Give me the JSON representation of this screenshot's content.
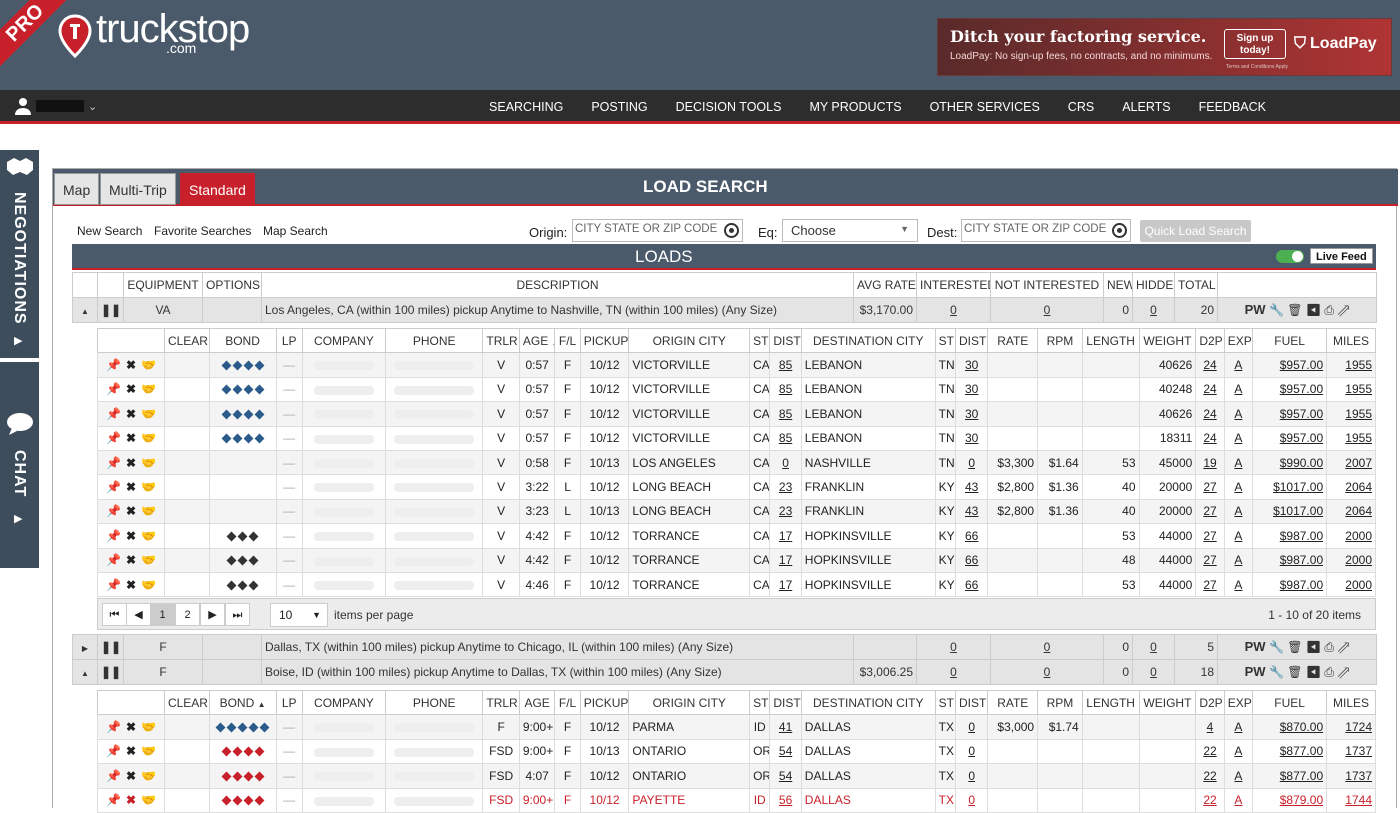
{
  "brand": {
    "pro": "PRO",
    "logo": "truckstop",
    "logo_com": ".com"
  },
  "ad": {
    "headline": "Ditch your factoring service.",
    "sub": "LoadPay: No sign-up fees, no contracts, and no minimums.",
    "button": "Sign up today!",
    "terms": "Terms and Conditions Apply",
    "brand": "LoadPay"
  },
  "nav": [
    "SEARCHING",
    "POSTING",
    "DECISION TOOLS",
    "MY PRODUCTS",
    "OTHER SERVICES",
    "CRS",
    "ALERTS",
    "FEEDBACK"
  ],
  "side": {
    "neg": "NEGOTIATIONS",
    "chat": "CHAT"
  },
  "tabs": [
    "Map",
    "Multi-Trip",
    "Standard"
  ],
  "panel_title": "LOAD SEARCH",
  "search": {
    "links": [
      "New Search",
      "Favorite Searches",
      "Map Search"
    ],
    "origin_label": "Origin:",
    "origin_ph": "CITY STATE OR ZIP CODE",
    "eq_label": "Eq:",
    "eq_value": "Choose",
    "dest_label": "Dest:",
    "dest_ph": "CITY STATE OR ZIP CODE",
    "button": "Quick Load Search"
  },
  "loads_title": "LOADS",
  "live_feed": "Live Feed",
  "top_headers": [
    "EQUIPMENT",
    "OPTIONS",
    "DESCRIPTION",
    "AVG RATE",
    "INTERESTED",
    "NOT INTERESTED",
    "NEW",
    "HIDDEN",
    "TOTAL"
  ],
  "groups": [
    {
      "eq": "VA",
      "desc": "Los Angeles, CA (within 100 miles) pickup Anytime to Nashville, TN (within 100 miles) (Any Size)",
      "avg": "$3,170.00",
      "int": "0",
      "notint": "0",
      "new": "0",
      "hidden": "0",
      "total": "20"
    },
    {
      "eq": "F",
      "desc": "Dallas, TX (within 100 miles) pickup Anytime to Chicago, IL (within 100 miles) (Any Size)",
      "avg": "",
      "int": "0",
      "notint": "0",
      "new": "0",
      "hidden": "0",
      "total": "5"
    },
    {
      "eq": "F",
      "desc": "Boise, ID (within 100 miles) pickup Anytime to Dallas, TX (within 100 miles) (Any Size)",
      "avg": "$3,006.25",
      "int": "0",
      "notint": "0",
      "new": "0",
      "hidden": "0",
      "total": "18"
    }
  ],
  "pw": "PW",
  "sub_headers": [
    "CLEAR",
    "BOND",
    "LP",
    "COMPANY",
    "PHONE",
    "TRLR",
    "AGE",
    "F/L",
    "PICKUP",
    "ORIGIN CITY",
    "ST",
    "DIST",
    "DESTINATION CITY",
    "ST",
    "DIST",
    "RATE",
    "RPM",
    "LENGTH",
    "WEIGHT",
    "D2P",
    "EXP",
    "FUEL",
    "MILES"
  ],
  "rows1": [
    {
      "bond": 4,
      "bc": "#2b5b8a",
      "trlr": "V",
      "age": "0:57",
      "fl": "F",
      "pu": "10/12",
      "oc": "VICTORVILLE",
      "ost": "CA",
      "od": "85",
      "dc": "LEBANON",
      "dst": "TN",
      "dd": "30",
      "rate": "",
      "rpm": "",
      "len": "",
      "wt": "40626",
      "d2p": "24",
      "exp": "A",
      "fuel": "$957.00",
      "mi": "1955"
    },
    {
      "bond": 4,
      "bc": "#2b5b8a",
      "trlr": "V",
      "age": "0:57",
      "fl": "F",
      "pu": "10/12",
      "oc": "VICTORVILLE",
      "ost": "CA",
      "od": "85",
      "dc": "LEBANON",
      "dst": "TN",
      "dd": "30",
      "rate": "",
      "rpm": "",
      "len": "",
      "wt": "40248",
      "d2p": "24",
      "exp": "A",
      "fuel": "$957.00",
      "mi": "1955"
    },
    {
      "bond": 4,
      "bc": "#2b5b8a",
      "trlr": "V",
      "age": "0:57",
      "fl": "F",
      "pu": "10/12",
      "oc": "VICTORVILLE",
      "ost": "CA",
      "od": "85",
      "dc": "LEBANON",
      "dst": "TN",
      "dd": "30",
      "rate": "",
      "rpm": "",
      "len": "",
      "wt": "40626",
      "d2p": "24",
      "exp": "A",
      "fuel": "$957.00",
      "mi": "1955"
    },
    {
      "bond": 4,
      "bc": "#2b5b8a",
      "trlr": "V",
      "age": "0:57",
      "fl": "F",
      "pu": "10/12",
      "oc": "VICTORVILLE",
      "ost": "CA",
      "od": "85",
      "dc": "LEBANON",
      "dst": "TN",
      "dd": "30",
      "rate": "",
      "rpm": "",
      "len": "",
      "wt": "18311",
      "d2p": "24",
      "exp": "A",
      "fuel": "$957.00",
      "mi": "1955"
    },
    {
      "bond": 0,
      "bc": "",
      "trlr": "V",
      "age": "0:58",
      "fl": "F",
      "pu": "10/13",
      "oc": "LOS ANGELES",
      "ost": "CA",
      "od": "0",
      "dc": "NASHVILLE",
      "dst": "TN",
      "dd": "0",
      "rate": "$3,300",
      "rpm": "$1.64",
      "len": "53",
      "wt": "45000",
      "d2p": "19",
      "exp": "A",
      "fuel": "$990.00",
      "mi": "2007"
    },
    {
      "bond": 0,
      "bc": "",
      "trlr": "V",
      "age": "3:22",
      "fl": "L",
      "pu": "10/12",
      "oc": "LONG BEACH",
      "ost": "CA",
      "od": "23",
      "dc": "FRANKLIN",
      "dst": "KY",
      "dd": "43",
      "rate": "$2,800",
      "rpm": "$1.36",
      "len": "40",
      "wt": "20000",
      "d2p": "27",
      "exp": "A",
      "fuel": "$1017.00",
      "mi": "2064"
    },
    {
      "bond": 0,
      "bc": "",
      "trlr": "V",
      "age": "3:23",
      "fl": "L",
      "pu": "10/13",
      "oc": "LONG BEACH",
      "ost": "CA",
      "od": "23",
      "dc": "FRANKLIN",
      "dst": "KY",
      "dd": "43",
      "rate": "$2,800",
      "rpm": "$1.36",
      "len": "40",
      "wt": "20000",
      "d2p": "27",
      "exp": "A",
      "fuel": "$1017.00",
      "mi": "2064"
    },
    {
      "bond": 3,
      "bc": "#333",
      "trlr": "V",
      "age": "4:42",
      "fl": "F",
      "pu": "10/12",
      "oc": "TORRANCE",
      "ost": "CA",
      "od": "17",
      "dc": "HOPKINSVILLE",
      "dst": "KY",
      "dd": "66",
      "rate": "",
      "rpm": "",
      "len": "53",
      "wt": "44000",
      "d2p": "27",
      "exp": "A",
      "fuel": "$987.00",
      "mi": "2000"
    },
    {
      "bond": 3,
      "bc": "#333",
      "trlr": "V",
      "age": "4:42",
      "fl": "F",
      "pu": "10/12",
      "oc": "TORRANCE",
      "ost": "CA",
      "od": "17",
      "dc": "HOPKINSVILLE",
      "dst": "KY",
      "dd": "66",
      "rate": "",
      "rpm": "",
      "len": "48",
      "wt": "44000",
      "d2p": "27",
      "exp": "A",
      "fuel": "$987.00",
      "mi": "2000"
    },
    {
      "bond": 3,
      "bc": "#333",
      "trlr": "V",
      "age": "4:46",
      "fl": "F",
      "pu": "10/12",
      "oc": "TORRANCE",
      "ost": "CA",
      "od": "17",
      "dc": "HOPKINSVILLE",
      "dst": "KY",
      "dd": "66",
      "rate": "",
      "rpm": "",
      "len": "53",
      "wt": "44000",
      "d2p": "27",
      "exp": "A",
      "fuel": "$987.00",
      "mi": "2000"
    }
  ],
  "pager": {
    "page1": "1",
    "page2": "2",
    "size": "10",
    "per": "items per page",
    "info": "1 - 10 of 20 items"
  },
  "rows3": [
    {
      "bond": 5,
      "bc": "#2b5b8a",
      "trlr": "F",
      "age": "9:00+",
      "fl": "F",
      "pu": "10/12",
      "oc": "PARMA",
      "ost": "ID",
      "od": "41",
      "dc": "DALLAS",
      "dst": "TX",
      "dd": "0",
      "rate": "$3,000",
      "rpm": "$1.74",
      "len": "",
      "wt": "",
      "d2p": "4",
      "exp": "A",
      "fuel": "$870.00",
      "mi": "1724"
    },
    {
      "bond": 4,
      "bc": "#c8202a",
      "trlr": "FSD",
      "age": "9:00+",
      "fl": "F",
      "pu": "10/13",
      "oc": "ONTARIO",
      "ost": "OR",
      "od": "54",
      "dc": "DALLAS",
      "dst": "TX",
      "dd": "0",
      "rate": "",
      "rpm": "",
      "len": "",
      "wt": "",
      "d2p": "22",
      "exp": "A",
      "fuel": "$877.00",
      "mi": "1737"
    },
    {
      "bond": 4,
      "bc": "#c8202a",
      "trlr": "FSD",
      "age": "4:07",
      "fl": "F",
      "pu": "10/12",
      "oc": "ONTARIO",
      "ost": "OR",
      "od": "54",
      "dc": "DALLAS",
      "dst": "TX",
      "dd": "0",
      "rate": "",
      "rpm": "",
      "len": "",
      "wt": "",
      "d2p": "22",
      "exp": "A",
      "fuel": "$877.00",
      "mi": "1737"
    },
    {
      "bond": 4,
      "bc": "#c8202a",
      "trlr": "FSD",
      "age": "9:00+",
      "fl": "F",
      "pu": "10/12",
      "oc": "PAYETTE",
      "ost": "ID",
      "od": "56",
      "dc": "DALLAS",
      "dst": "TX",
      "dd": "0",
      "rate": "",
      "rpm": "",
      "len": "",
      "wt": "",
      "d2p": "22",
      "exp": "A",
      "fuel": "$879.00",
      "mi": "1744"
    }
  ]
}
